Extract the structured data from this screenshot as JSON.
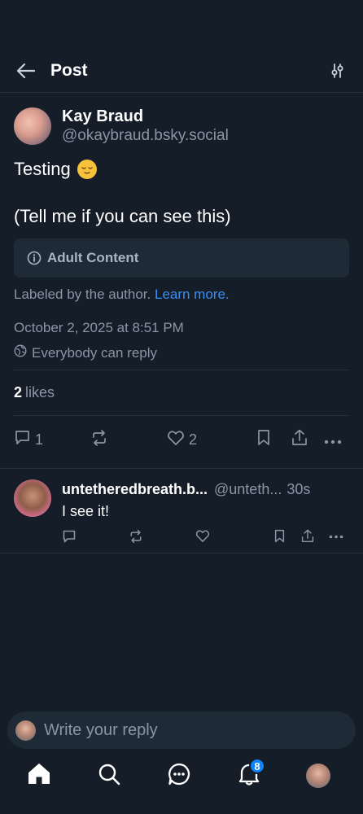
{
  "header": {
    "title": "Post"
  },
  "post": {
    "author_name": "Kay Braud",
    "author_handle": "@okaybraud.bsky.social",
    "text_line1": "Testing",
    "text_line2": "(Tell me if you can see this)",
    "label_title": "Adult Content",
    "labeled_by": "Labeled by the author.",
    "learn_more": "Learn more.",
    "timestamp": "October 2, 2025 at 8:51 PM",
    "reply_rule": "Everybody can reply",
    "likes_count": "2",
    "likes_label": "likes",
    "reply_count": "1",
    "like_count": "2"
  },
  "reply": {
    "author_name": "untetheredbreath.b...",
    "author_handle": "@unteth...",
    "time": "30s",
    "text": "I see it!"
  },
  "composer": {
    "placeholder": "Write your reply"
  },
  "tabbar": {
    "notifications_badge": "8"
  },
  "colors": {
    "background": "#151d28",
    "accent": "#3b8ff0",
    "badge": "#1083fe",
    "muted_text": "#8a96a6"
  }
}
